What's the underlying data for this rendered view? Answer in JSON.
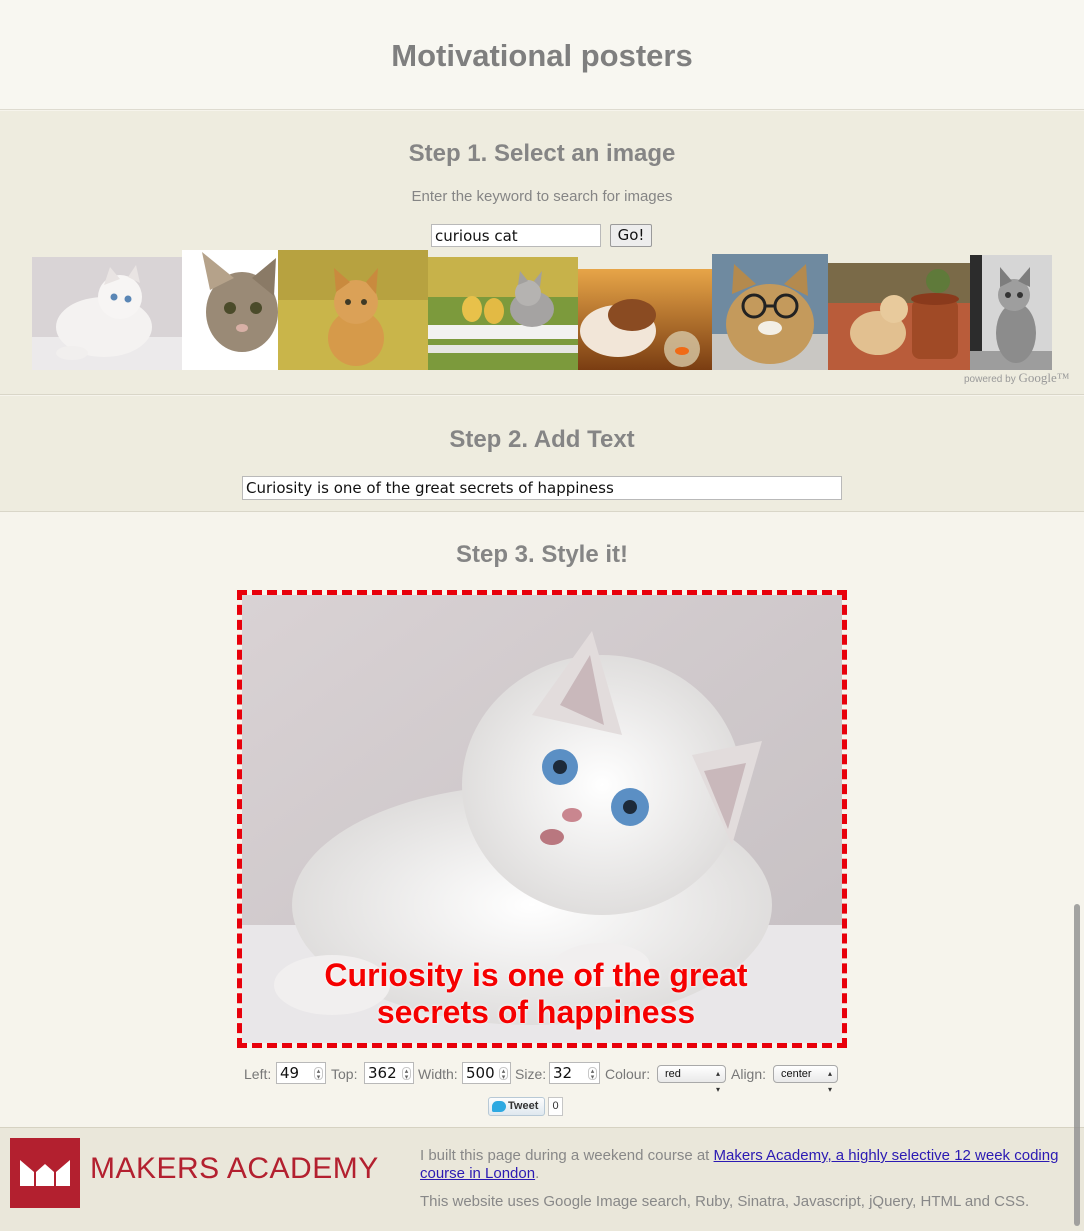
{
  "page": {
    "title": "Motivational posters"
  },
  "step1": {
    "heading": "Step 1. Select an image",
    "hint": "Enter the keyword to search for images",
    "search_value": "curious cat",
    "go_label": "Go!",
    "powered_by": "powered by",
    "google": "Google™",
    "thumbnails": [
      "white fluffy kitten lying",
      "tabby kitten peeking",
      "orange kitten on yellow",
      "kitten with ducklings on bench",
      "cat watching goldfish bowl",
      "cat wearing glasses",
      "kitten climbing flower pot",
      "tabby cat at window"
    ]
  },
  "step2": {
    "heading": "Step 2. Add Text",
    "text_value": "Curiosity is one of the great secrets of happiness"
  },
  "step3": {
    "heading": "Step 3. Style it!",
    "poster_text": "Curiosity is one of the great secrets of happiness",
    "text_color": "#f50000",
    "border_color": "#e8000b",
    "controls": {
      "left_label": "Left:",
      "left_value": "49",
      "top_label": "Top:",
      "top_value": "362",
      "width_label": "Width:",
      "width_value": "500",
      "size_label": "Size:",
      "size_value": "32",
      "colour_label": "Colour:",
      "colour_value": "red",
      "align_label": "Align:",
      "align_value": "center"
    },
    "tweet_label": "Tweet",
    "tweet_count": "0"
  },
  "footer": {
    "brand": "MAKERS ACADEMY",
    "text_before_link": "I built this page during a weekend course at ",
    "link_text": "Makers Academy, a highly selective 12 week coding course in London",
    "text_after_link": ".",
    "tech_note": "This website uses Google Image search, Ruby, Sinatra, Javascript, jQuery, HTML and CSS.",
    "brand_color": "#b3202f"
  }
}
